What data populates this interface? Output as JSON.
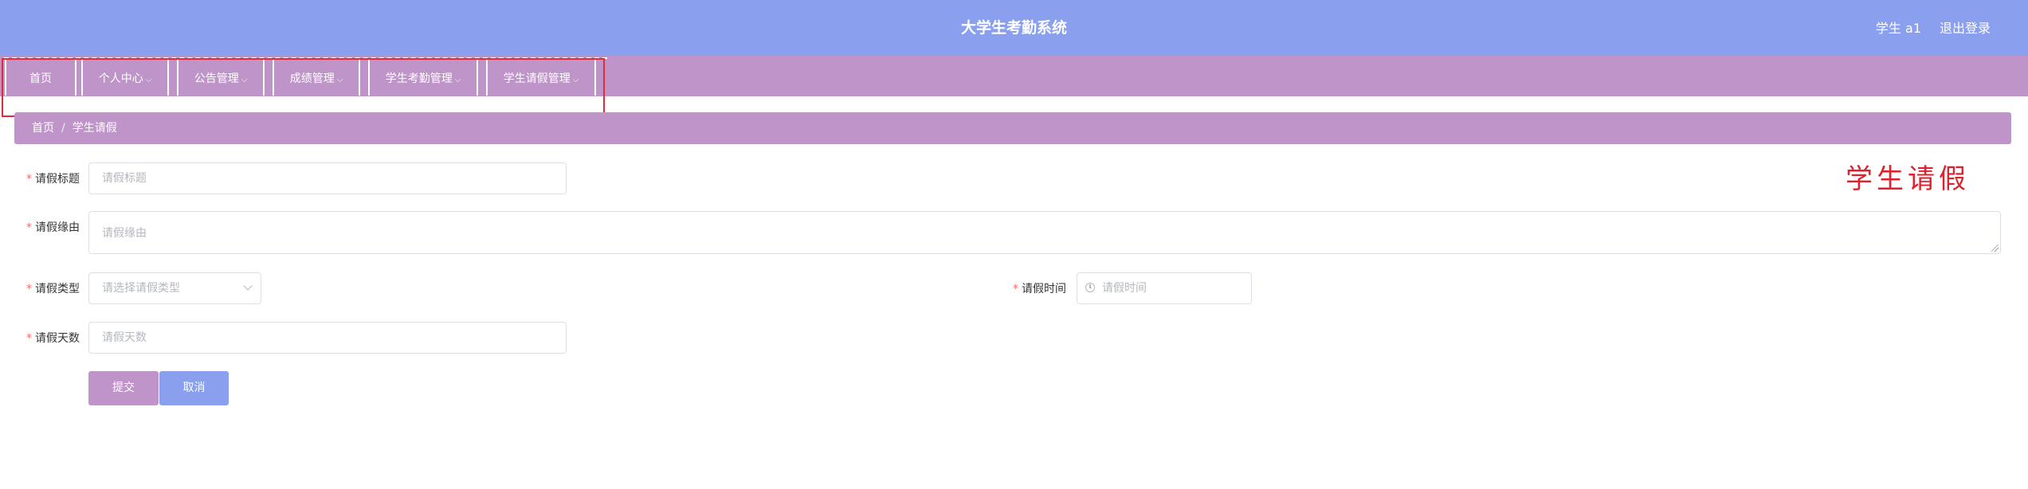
{
  "header": {
    "title": "大学生考勤系统",
    "user": "学生 a1",
    "logout": "退出登录"
  },
  "nav": {
    "items": [
      {
        "label": "首页",
        "has_dropdown": false
      },
      {
        "label": "个人中心",
        "has_dropdown": true
      },
      {
        "label": "公告管理",
        "has_dropdown": true
      },
      {
        "label": "成绩管理",
        "has_dropdown": true
      },
      {
        "label": "学生考勤管理",
        "has_dropdown": true
      },
      {
        "label": "学生请假管理",
        "has_dropdown": true
      }
    ],
    "caret": "⌵"
  },
  "breadcrumb": {
    "home": "首页",
    "separator": "/",
    "current": "学生请假"
  },
  "page_label": "学生请假",
  "form": {
    "required_mark": "*",
    "title": {
      "label": "请假标题",
      "placeholder": "请假标题"
    },
    "reason": {
      "label": "请假缘由",
      "placeholder": "请假缘由"
    },
    "type": {
      "label": "请假类型",
      "placeholder": "请选择请假类型"
    },
    "time": {
      "label": "请假时间",
      "placeholder": "请假时间"
    },
    "days": {
      "label": "请假天数",
      "placeholder": "请假天数"
    },
    "submit": "提交",
    "cancel": "取消"
  },
  "colors": {
    "header": "#8aa0ee",
    "nav": "#bf95c9",
    "submit": "#bf95c9",
    "cancel": "#8aa0ee",
    "highlight": "#e42a3a"
  }
}
